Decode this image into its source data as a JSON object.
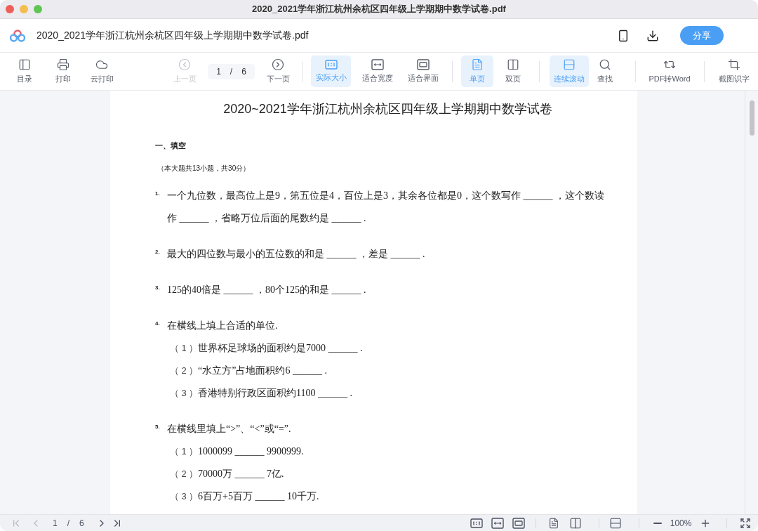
{
  "window": {
    "title": "2020_2021学年浙江杭州余杭区四年级上学期期中数学试卷.pdf"
  },
  "header": {
    "filename": "2020_2021学年浙江杭州余杭区四年级上学期期中数学试卷.pdf",
    "share_label": "分享"
  },
  "toolbar": {
    "groups": [
      [
        {
          "kind": "button",
          "label": "目录",
          "selected": false,
          "disabled": false
        },
        {
          "kind": "button",
          "label": "打印",
          "selected": false,
          "disabled": false
        },
        {
          "kind": "button",
          "label": "云打印",
          "selected": false,
          "disabled": false
        }
      ],
      [
        {
          "kind": "button",
          "label": "上一页",
          "selected": false,
          "disabled": true
        },
        {
          "kind": "pager",
          "current": "1",
          "separator": "/",
          "total": "6"
        },
        {
          "kind": "button",
          "label": "下一页",
          "selected": false,
          "disabled": false
        }
      ],
      [
        {
          "kind": "button",
          "label": "实际大小",
          "selected": true,
          "disabled": false
        },
        {
          "kind": "button",
          "label": "适合宽度",
          "selected": false,
          "disabled": false
        },
        {
          "kind": "button",
          "label": "适合界面",
          "selected": false,
          "disabled": false
        }
      ],
      [
        {
          "kind": "button",
          "label": "单页",
          "selected": true,
          "disabled": false
        },
        {
          "kind": "button",
          "label": "双页",
          "selected": false,
          "disabled": false
        }
      ],
      [
        {
          "kind": "button",
          "label": "连续滚动",
          "selected": true,
          "disabled": false
        },
        {
          "kind": "button",
          "label": "查找",
          "selected": false,
          "disabled": false
        }
      ],
      [
        {
          "kind": "button",
          "label": "PDF转Word",
          "selected": false,
          "disabled": false
        }
      ],
      [
        {
          "kind": "button",
          "label": "截图识字",
          "selected": false,
          "disabled": false
        }
      ]
    ]
  },
  "document": {
    "title": "2020~2021学年浙江杭州余杭区四年级上学期期中数学试卷",
    "section": "一、填空",
    "note": "（本大题共13小题，共30分）",
    "questions": [
      {
        "number": "1.",
        "lines": [
          "一个九位数，最高位上是9，第五位是4，百位上是3，其余各位都是0，这个数写作 ______ ，这个数读",
          "作 ______ ，省略万位后面的尾数约是 ______ ."
        ]
      },
      {
        "number": "2.",
        "lines": [
          "最大的四位数与最小的五位数的和是 ______ ，差是 ______ ."
        ]
      },
      {
        "number": "3.",
        "lines": [
          "125的40倍是 ______ ，80个125的和是 ______ ."
        ]
      },
      {
        "number": "4.",
        "lines": [
          "在横线上填上合适的单位."
        ],
        "parts": [
          {
            "label": "（ 1 ）",
            "text": "世界杯足球场的面积约是7000 ______ ."
          },
          {
            "label": "（ 2 ）",
            "text": "“水立方”占地面积约6 ______ ."
          },
          {
            "label": "（ 3 ）",
            "text": "香港特别行政区面积约1100 ______ ."
          }
        ]
      },
      {
        "number": "5.",
        "lines": [
          "在横线里填上“>”、“<”或“=”."
        ],
        "parts": [
          {
            "label": "（ 1 ）",
            "text": "1000099 ______ 9900999."
          },
          {
            "label": "（ 2 ）",
            "text": "70000万 ______ 7亿."
          },
          {
            "label": "（ 3 ）",
            "text": "6百万+5百万 ______ 10千万."
          }
        ]
      }
    ]
  },
  "status_bar": {
    "first_disabled": true,
    "prev_disabled": true,
    "current": "1",
    "separator": "/",
    "total": "6",
    "zoom": "100%"
  }
}
